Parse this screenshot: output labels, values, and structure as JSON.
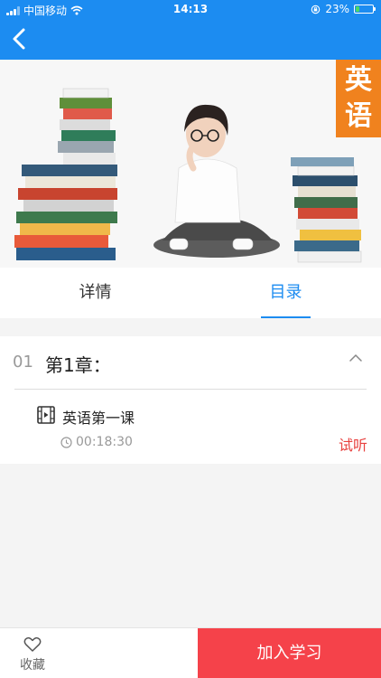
{
  "status": {
    "carrier": "中国移动",
    "time": "14:13",
    "battery": "23%",
    "battery_level": 0.23
  },
  "nav": {
    "back_icon": "chevron-left-icon"
  },
  "hero": {
    "tag": "英语"
  },
  "tabs": [
    {
      "label": "详情",
      "active": false
    },
    {
      "label": "目录",
      "active": true
    }
  ],
  "catalog": {
    "chapter": {
      "number": "01",
      "title": "第1章：",
      "expanded": true
    },
    "lesson": {
      "name": "英语第一课",
      "duration": "00:18:30",
      "action": "试听"
    }
  },
  "bottom": {
    "favorite_label": "收藏",
    "join_label": "加入学习"
  },
  "colors": {
    "primary": "#1c8cf1",
    "accent": "#f5424a",
    "tag": "#f0821e",
    "trial": "#e8413f"
  }
}
